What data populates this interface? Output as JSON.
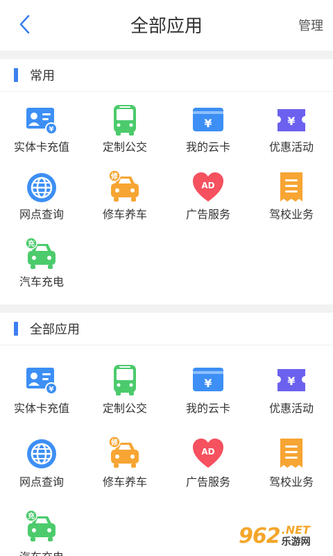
{
  "header": {
    "title": "全部应用",
    "manage_label": "管理",
    "back_icon": "chevron-left-icon"
  },
  "sections": [
    {
      "title": "常用",
      "items": [
        {
          "label": "实体卡充值",
          "icon": "card-recharge-icon"
        },
        {
          "label": "定制公交",
          "icon": "bus-icon"
        },
        {
          "label": "我的云卡",
          "icon": "cloud-card-icon"
        },
        {
          "label": "优惠活动",
          "icon": "coupon-icon"
        },
        {
          "label": "网点查询",
          "icon": "globe-icon"
        },
        {
          "label": "修车养车",
          "icon": "car-repair-icon",
          "badge": "修"
        },
        {
          "label": "广告服务",
          "icon": "heart-ad-icon",
          "badge": "AD"
        },
        {
          "label": "驾校业务",
          "icon": "receipt-icon"
        },
        {
          "label": "汽车充电",
          "icon": "car-charge-icon",
          "badge": "充"
        }
      ]
    },
    {
      "title": "全部应用",
      "items": [
        {
          "label": "实体卡充值",
          "icon": "card-recharge-icon"
        },
        {
          "label": "定制公交",
          "icon": "bus-icon"
        },
        {
          "label": "我的云卡",
          "icon": "cloud-card-icon"
        },
        {
          "label": "优惠活动",
          "icon": "coupon-icon"
        },
        {
          "label": "网点查询",
          "icon": "globe-icon"
        },
        {
          "label": "修车养车",
          "icon": "car-repair-icon",
          "badge": "修"
        },
        {
          "label": "广告服务",
          "icon": "heart-ad-icon",
          "badge": "AD"
        },
        {
          "label": "驾校业务",
          "icon": "receipt-icon"
        },
        {
          "label": "汽车充电",
          "icon": "car-charge-icon",
          "badge": "充"
        }
      ]
    }
  ],
  "watermark": {
    "logo": "962",
    "suffix": ".NET",
    "text": "乐游网"
  },
  "colors": {
    "accent": "#3d7ff0",
    "blue": "#3d8ff5",
    "green": "#4ccb6c",
    "orange": "#f7a533",
    "purple": "#6c61ef",
    "red": "#f5515f"
  }
}
